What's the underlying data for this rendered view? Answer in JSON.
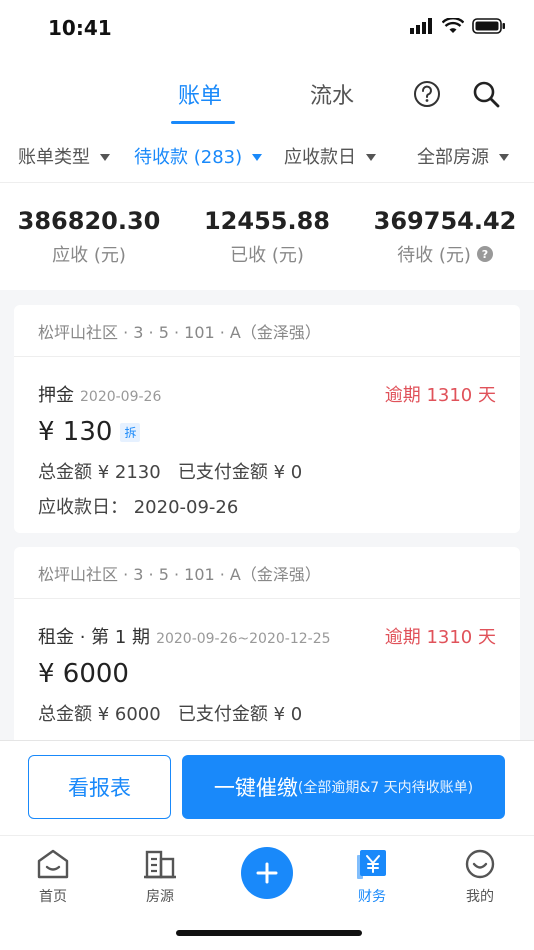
{
  "status": {
    "time": "10:41"
  },
  "header": {
    "tabs": [
      {
        "label": "账单"
      },
      {
        "label": "流水"
      }
    ]
  },
  "filters": [
    {
      "label": "账单类型"
    },
    {
      "label": "待收款 (283)"
    },
    {
      "label": "应收款日"
    },
    {
      "label": "全部房源"
    }
  ],
  "summary": [
    {
      "value": "386820.30",
      "label": "应收 (元)"
    },
    {
      "value": "12455.88",
      "label": "已收 (元)"
    },
    {
      "value": "369754.42",
      "label": "待收 (元)"
    }
  ],
  "bills": [
    {
      "property": "松坪山社区 · 3 · 5 · 101 · A（金泽强）",
      "type": "押金",
      "date": "2020-09-26",
      "overdue": "逾期 1310 天",
      "amount": "¥ 130",
      "tag": "拆",
      "total": "总金额 ¥ 2130",
      "paid": "已支付金额 ¥ 0",
      "due": "应收款日：  2020-09-26"
    },
    {
      "property": "松坪山社区 · 3 · 5 · 101 · A（金泽强）",
      "type": "租金 · 第 1 期",
      "date": "2020-09-26~2020-12-25",
      "overdue": "逾期 1310 天",
      "amount": "¥ 6000",
      "total": "总金额 ¥ 6000",
      "paid": "已支付金额 ¥ 0"
    }
  ],
  "actions": {
    "report": "看报表",
    "remind": "一键催缴",
    "remind_sub": "(全部逾期&7 天内待收账单)"
  },
  "tabbar": [
    {
      "label": "首页"
    },
    {
      "label": "房源"
    },
    {
      "label": "财务"
    },
    {
      "label": "我的"
    }
  ],
  "colors": {
    "accent": "#1989fa",
    "overdue": "#e0525a"
  }
}
